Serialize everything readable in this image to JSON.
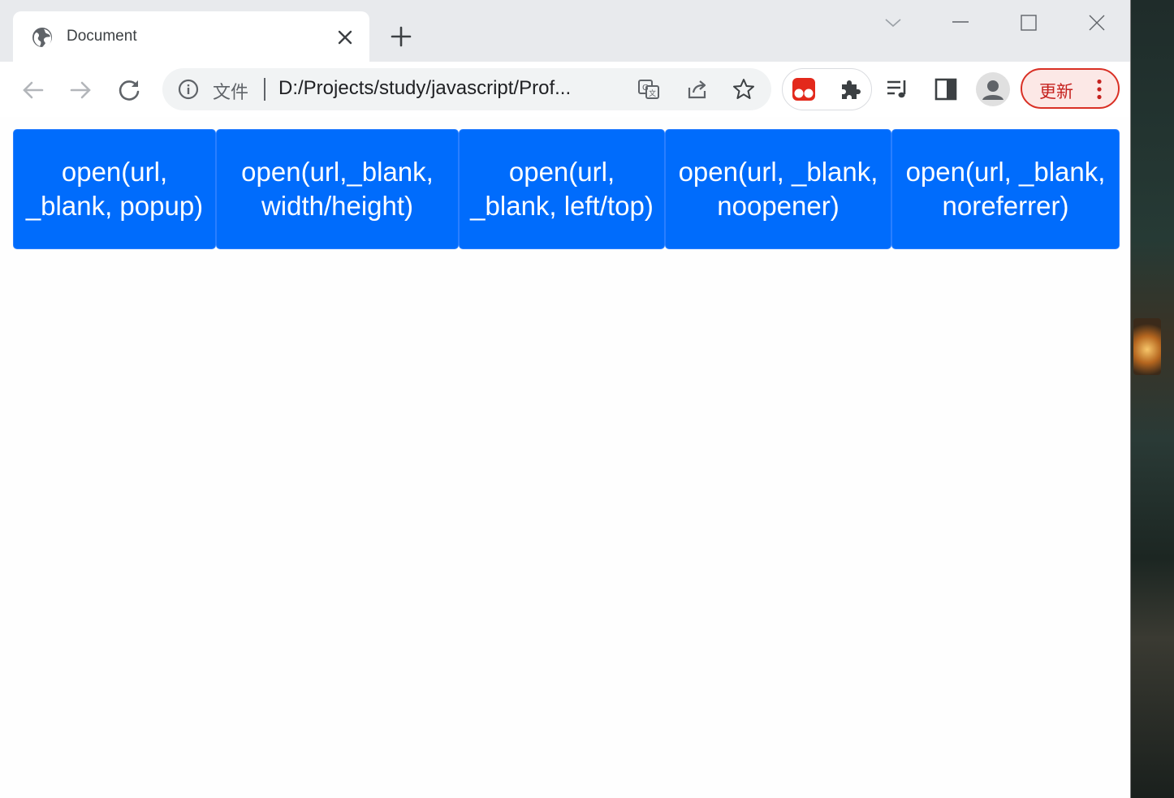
{
  "tab": {
    "title": "Document"
  },
  "omnibox": {
    "scheme_label": "文件",
    "url": "D:/Projects/study/javascript/Prof..."
  },
  "update_button": {
    "label": "更新"
  },
  "buttons": [
    {
      "label": "open(url, _blank, popup)"
    },
    {
      "label": "open(url,_blank, width/height)"
    },
    {
      "label": "open(url, _blank, left/top)"
    },
    {
      "label": "open(url, _blank, noopener)"
    },
    {
      "label": "open(url, _blank, noreferrer)"
    }
  ],
  "colors": {
    "button_bg": "#006cfc",
    "button_text": "#ffffff",
    "update_border": "#d93025",
    "update_bg": "#fce8e6"
  },
  "icons": {
    "tab": [
      "globe-icon",
      "close-icon"
    ],
    "tabbar": [
      "new-tab-icon",
      "tab-search-icon",
      "minimize-icon",
      "maximize-icon",
      "window-close-icon"
    ],
    "toolbar": [
      "back-icon",
      "forward-icon",
      "reload-icon",
      "info-icon",
      "translate-icon",
      "share-icon",
      "bookmark-star-icon",
      "tampermonkey-icon",
      "extensions-icon",
      "media-queue-icon",
      "side-panel-icon",
      "profile-icon",
      "more-menu-icon"
    ]
  }
}
